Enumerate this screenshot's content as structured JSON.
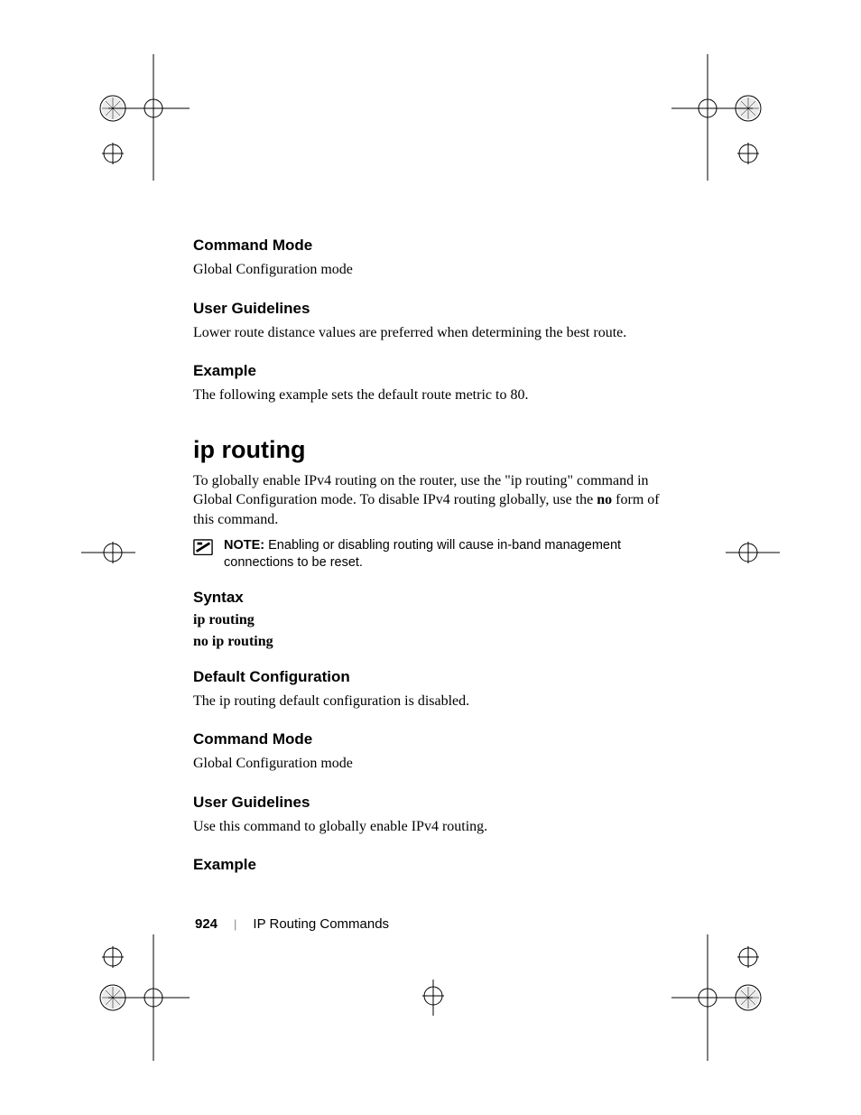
{
  "sections": {
    "cmdmode1": {
      "heading": "Command Mode",
      "text": "Global Configuration mode"
    },
    "guidelines1": {
      "heading": "User Guidelines",
      "text": "Lower route distance values are preferred when determining the best route."
    },
    "example1": {
      "heading": "Example",
      "text": "The following example sets the default route metric to 80."
    },
    "title": "ip routing",
    "intro_pre": "To globally enable IPv4 routing on the router, use the \"ip routing\" command in Global Configuration mode. To disable IPv4 routing globally, use the ",
    "intro_bold": "no",
    "intro_post": " form of this command.",
    "note": {
      "label": "NOTE:",
      "text": " Enabling or disabling routing will cause in-band management connections to be reset."
    },
    "syntax": {
      "heading": "Syntax",
      "line1": "ip routing",
      "line2": "no ip routing"
    },
    "defaultcfg": {
      "heading": "Default Configuration",
      "text": "The ip routing default configuration is disabled."
    },
    "cmdmode2": {
      "heading": "Command Mode",
      "text": "Global Configuration mode"
    },
    "guidelines2": {
      "heading": "User Guidelines",
      "text": "Use this command to globally enable IPv4 routing."
    },
    "example2": {
      "heading": "Example"
    }
  },
  "footer": {
    "page": "924",
    "divider": "|",
    "section": "IP Routing Commands"
  }
}
